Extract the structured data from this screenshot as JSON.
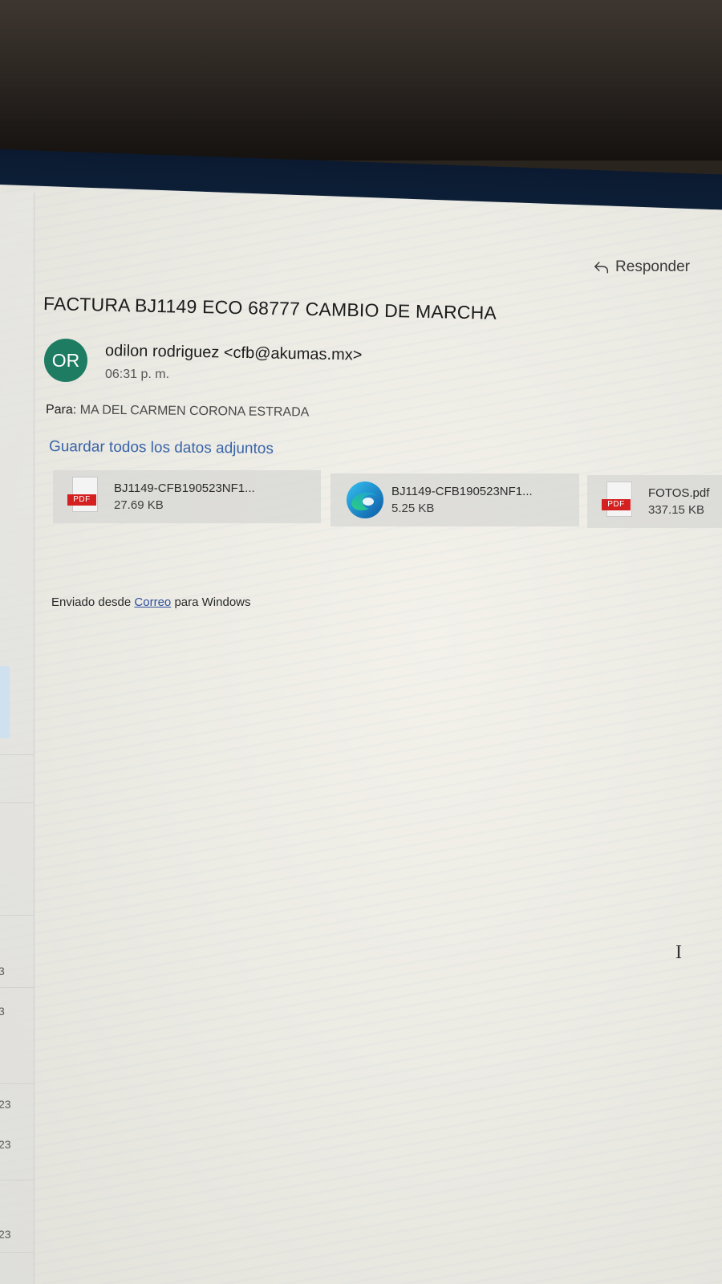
{
  "reading_pane": {
    "reply_label": "Responder",
    "subject": "FACTURA BJ1149 ECO 68777 CAMBIO DE MARCHA",
    "sender": {
      "initials": "OR",
      "name_and_email": "odilon rodriguez <cfb@akumas.mx>",
      "time": "06:31 p. m.",
      "avatar_color": "#1e7c62"
    },
    "to_label": "Para:",
    "to_value": "MA DEL CARMEN CORONA ESTRADA",
    "save_all_label": "Guardar todos los datos adjuntos",
    "attachments": [
      {
        "name": "BJ1149-CFB190523NF1...",
        "size": "27.69 KB",
        "icon": "pdf-file-icon"
      },
      {
        "name": "BJ1149-CFB190523NF1...",
        "size": "5.25 KB",
        "icon": "edge-browser-icon"
      },
      {
        "name": "FOTOS.pdf",
        "size": "337.15 KB",
        "icon": "pdf-file-icon"
      }
    ],
    "signature": {
      "prefix": "Enviado desde",
      "link": "Correo",
      "suffix": "para Windows"
    }
  },
  "message_list": {
    "visible_fragments": [
      "3",
      "3",
      "23",
      "23",
      "23"
    ]
  },
  "colors": {
    "link": "#3a64a8",
    "pdf_badge": "#d42020"
  }
}
